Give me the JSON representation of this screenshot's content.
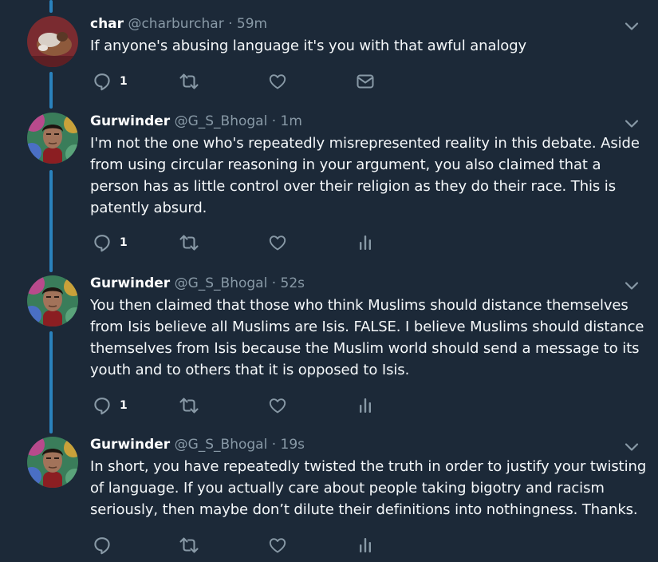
{
  "tweets": [
    {
      "name": "char",
      "handle": "@charburchar",
      "time": "· 59m",
      "text": "If anyone's abusing language it's you with that awful analogy",
      "reply_count": "1",
      "last_action": "mail-icon",
      "avatar": "cat-photo"
    },
    {
      "name": "Gurwinder",
      "handle": "@G_S_Bhogal",
      "time": "· 1m",
      "text": "I'm not the one who's repeatedly misrepresented reality in this debate. Aside from using circular reasoning in your argument, you also claimed that a person has as little control over their religion as they do their race. This is patently absurd.",
      "reply_count": "1",
      "last_action": "analytics-icon",
      "avatar": "man-portrait"
    },
    {
      "name": "Gurwinder",
      "handle": "@G_S_Bhogal",
      "time": "· 52s",
      "text": "You then claimed that those who think Muslims should distance themselves from Isis believe all Muslims are Isis. FALSE. I believe Muslims should distance themselves from Isis because the Muslim world should send a message to its youth and to others that it is opposed to Isis.",
      "reply_count": "1",
      "last_action": "analytics-icon",
      "avatar": "man-portrait"
    },
    {
      "name": "Gurwinder",
      "handle": "@G_S_Bhogal",
      "time": "· 19s",
      "text": "In short, you have repeatedly twisted the truth in order to justify your twisting of language. If you actually care about people taking bigotry and racism seriously, then maybe don’t dilute their definitions into nothingness. Thanks.",
      "reply_count": "",
      "last_action": "analytics-icon",
      "avatar": "man-portrait"
    }
  ],
  "colors": {
    "background": "#1c2938",
    "thread_line": "#2a82bd",
    "secondary_text": "#8899a6",
    "icon": "#8899a6"
  }
}
